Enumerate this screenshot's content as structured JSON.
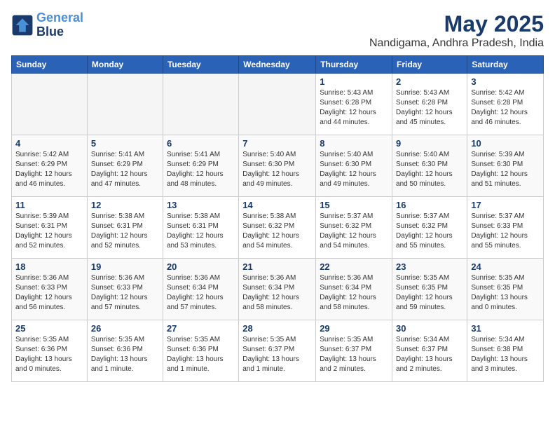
{
  "header": {
    "logo_line1": "General",
    "logo_line2": "Blue",
    "month": "May 2025",
    "location": "Nandigama, Andhra Pradesh, India"
  },
  "weekdays": [
    "Sunday",
    "Monday",
    "Tuesday",
    "Wednesday",
    "Thursday",
    "Friday",
    "Saturday"
  ],
  "weeks": [
    [
      {
        "day": "",
        "info": ""
      },
      {
        "day": "",
        "info": ""
      },
      {
        "day": "",
        "info": ""
      },
      {
        "day": "",
        "info": ""
      },
      {
        "day": "1",
        "info": "Sunrise: 5:43 AM\nSunset: 6:28 PM\nDaylight: 12 hours\nand 44 minutes."
      },
      {
        "day": "2",
        "info": "Sunrise: 5:43 AM\nSunset: 6:28 PM\nDaylight: 12 hours\nand 45 minutes."
      },
      {
        "day": "3",
        "info": "Sunrise: 5:42 AM\nSunset: 6:28 PM\nDaylight: 12 hours\nand 46 minutes."
      }
    ],
    [
      {
        "day": "4",
        "info": "Sunrise: 5:42 AM\nSunset: 6:29 PM\nDaylight: 12 hours\nand 46 minutes."
      },
      {
        "day": "5",
        "info": "Sunrise: 5:41 AM\nSunset: 6:29 PM\nDaylight: 12 hours\nand 47 minutes."
      },
      {
        "day": "6",
        "info": "Sunrise: 5:41 AM\nSunset: 6:29 PM\nDaylight: 12 hours\nand 48 minutes."
      },
      {
        "day": "7",
        "info": "Sunrise: 5:40 AM\nSunset: 6:30 PM\nDaylight: 12 hours\nand 49 minutes."
      },
      {
        "day": "8",
        "info": "Sunrise: 5:40 AM\nSunset: 6:30 PM\nDaylight: 12 hours\nand 49 minutes."
      },
      {
        "day": "9",
        "info": "Sunrise: 5:40 AM\nSunset: 6:30 PM\nDaylight: 12 hours\nand 50 minutes."
      },
      {
        "day": "10",
        "info": "Sunrise: 5:39 AM\nSunset: 6:30 PM\nDaylight: 12 hours\nand 51 minutes."
      }
    ],
    [
      {
        "day": "11",
        "info": "Sunrise: 5:39 AM\nSunset: 6:31 PM\nDaylight: 12 hours\nand 52 minutes."
      },
      {
        "day": "12",
        "info": "Sunrise: 5:38 AM\nSunset: 6:31 PM\nDaylight: 12 hours\nand 52 minutes."
      },
      {
        "day": "13",
        "info": "Sunrise: 5:38 AM\nSunset: 6:31 PM\nDaylight: 12 hours\nand 53 minutes."
      },
      {
        "day": "14",
        "info": "Sunrise: 5:38 AM\nSunset: 6:32 PM\nDaylight: 12 hours\nand 54 minutes."
      },
      {
        "day": "15",
        "info": "Sunrise: 5:37 AM\nSunset: 6:32 PM\nDaylight: 12 hours\nand 54 minutes."
      },
      {
        "day": "16",
        "info": "Sunrise: 5:37 AM\nSunset: 6:32 PM\nDaylight: 12 hours\nand 55 minutes."
      },
      {
        "day": "17",
        "info": "Sunrise: 5:37 AM\nSunset: 6:33 PM\nDaylight: 12 hours\nand 55 minutes."
      }
    ],
    [
      {
        "day": "18",
        "info": "Sunrise: 5:36 AM\nSunset: 6:33 PM\nDaylight: 12 hours\nand 56 minutes."
      },
      {
        "day": "19",
        "info": "Sunrise: 5:36 AM\nSunset: 6:33 PM\nDaylight: 12 hours\nand 57 minutes."
      },
      {
        "day": "20",
        "info": "Sunrise: 5:36 AM\nSunset: 6:34 PM\nDaylight: 12 hours\nand 57 minutes."
      },
      {
        "day": "21",
        "info": "Sunrise: 5:36 AM\nSunset: 6:34 PM\nDaylight: 12 hours\nand 58 minutes."
      },
      {
        "day": "22",
        "info": "Sunrise: 5:36 AM\nSunset: 6:34 PM\nDaylight: 12 hours\nand 58 minutes."
      },
      {
        "day": "23",
        "info": "Sunrise: 5:35 AM\nSunset: 6:35 PM\nDaylight: 12 hours\nand 59 minutes."
      },
      {
        "day": "24",
        "info": "Sunrise: 5:35 AM\nSunset: 6:35 PM\nDaylight: 13 hours\nand 0 minutes."
      }
    ],
    [
      {
        "day": "25",
        "info": "Sunrise: 5:35 AM\nSunset: 6:36 PM\nDaylight: 13 hours\nand 0 minutes."
      },
      {
        "day": "26",
        "info": "Sunrise: 5:35 AM\nSunset: 6:36 PM\nDaylight: 13 hours\nand 1 minute."
      },
      {
        "day": "27",
        "info": "Sunrise: 5:35 AM\nSunset: 6:36 PM\nDaylight: 13 hours\nand 1 minute."
      },
      {
        "day": "28",
        "info": "Sunrise: 5:35 AM\nSunset: 6:37 PM\nDaylight: 13 hours\nand 1 minute."
      },
      {
        "day": "29",
        "info": "Sunrise: 5:35 AM\nSunset: 6:37 PM\nDaylight: 13 hours\nand 2 minutes."
      },
      {
        "day": "30",
        "info": "Sunrise: 5:34 AM\nSunset: 6:37 PM\nDaylight: 13 hours\nand 2 minutes."
      },
      {
        "day": "31",
        "info": "Sunrise: 5:34 AM\nSunset: 6:38 PM\nDaylight: 13 hours\nand 3 minutes."
      }
    ]
  ]
}
